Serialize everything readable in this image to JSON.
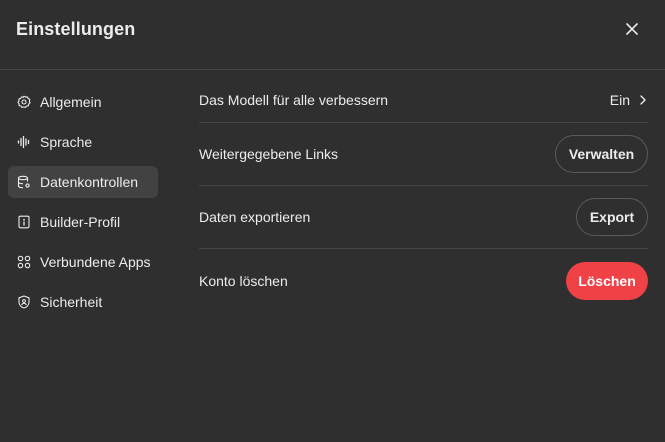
{
  "dialog": {
    "title": "Einstellungen",
    "close_icon": "close-icon"
  },
  "sidebar": {
    "items": [
      {
        "label": "Allgemein",
        "icon": "gear-icon",
        "active": false
      },
      {
        "label": "Sprache",
        "icon": "audio-waveform-icon",
        "active": false
      },
      {
        "label": "Datenkontrollen",
        "icon": "database-settings-icon",
        "active": true
      },
      {
        "label": "Builder-Profil",
        "icon": "id-card-icon",
        "active": false
      },
      {
        "label": "Verbundene Apps",
        "icon": "apps-grid-icon",
        "active": false
      },
      {
        "label": "Sicherheit",
        "icon": "shield-user-icon",
        "active": false
      }
    ]
  },
  "settings": {
    "rows": [
      {
        "label": "Das Modell für alle verbessern",
        "control": "link",
        "value": "Ein"
      },
      {
        "label": "Weitergegebene Links",
        "control": "button",
        "value": "Verwalten"
      },
      {
        "label": "Daten exportieren",
        "control": "button",
        "value": "Export"
      },
      {
        "label": "Konto löschen",
        "control": "danger-button",
        "value": "Löschen"
      }
    ]
  },
  "colors": {
    "background": "#2f2f2f",
    "active_item": "#424242",
    "divider": "#454545",
    "text": "#ececec",
    "danger": "#ef4146"
  }
}
